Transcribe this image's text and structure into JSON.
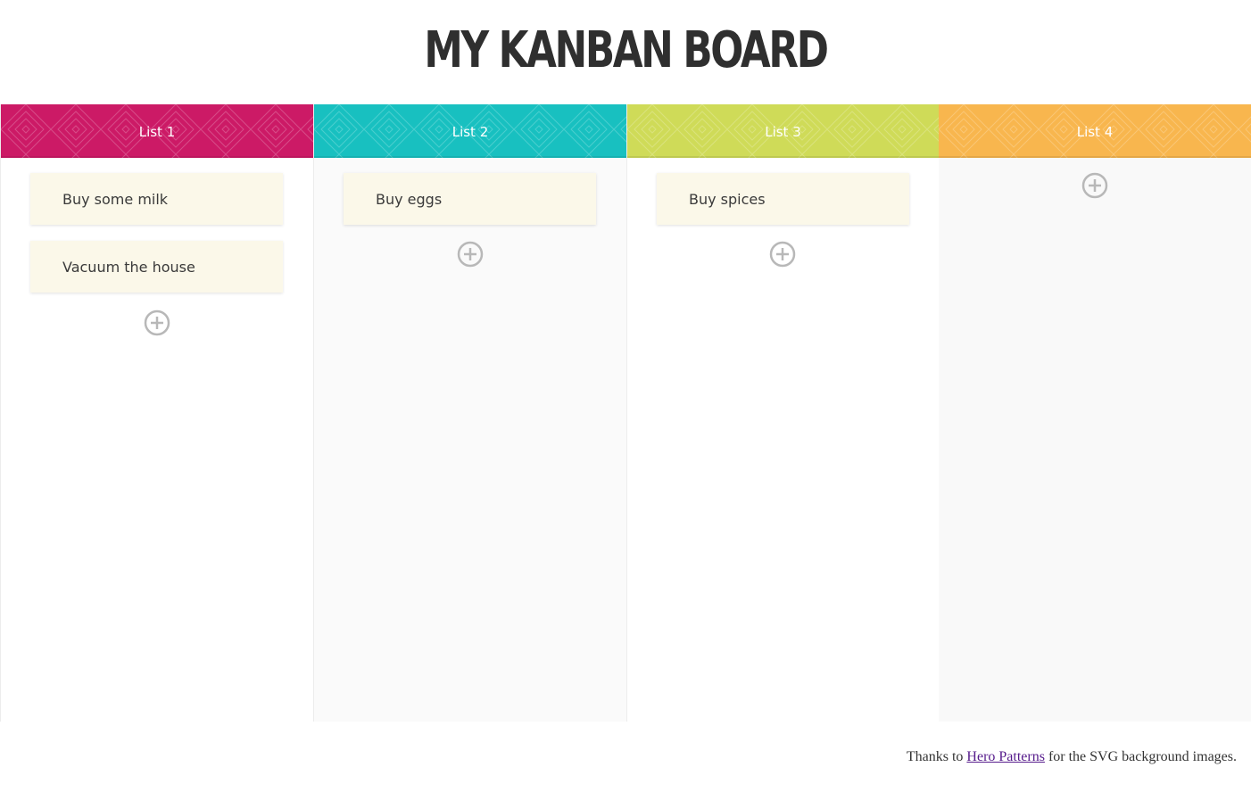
{
  "page": {
    "title": "MY KANBAN BOARD"
  },
  "lists": [
    {
      "name": "List 1",
      "color": "#cc1a66",
      "cards": [
        "Buy some milk",
        "Vacuum the house"
      ],
      "add_icon": "plus-circle-icon"
    },
    {
      "name": "List 2",
      "color": "#18c0c0",
      "cards": [
        "Buy eggs"
      ],
      "add_icon": "plus-circle-icon"
    },
    {
      "name": "List 3",
      "color": "#cfdb58",
      "cards": [
        "Buy spices"
      ],
      "add_icon": "plus-circle-icon"
    },
    {
      "name": "List 4",
      "color": "#f8b64e",
      "cards": [],
      "add_icon": "plus-circle-icon"
    }
  ],
  "footer": {
    "prefix": "Thanks to",
    "link_text": "Hero Patterns",
    "suffix": "for the SVG background images."
  }
}
